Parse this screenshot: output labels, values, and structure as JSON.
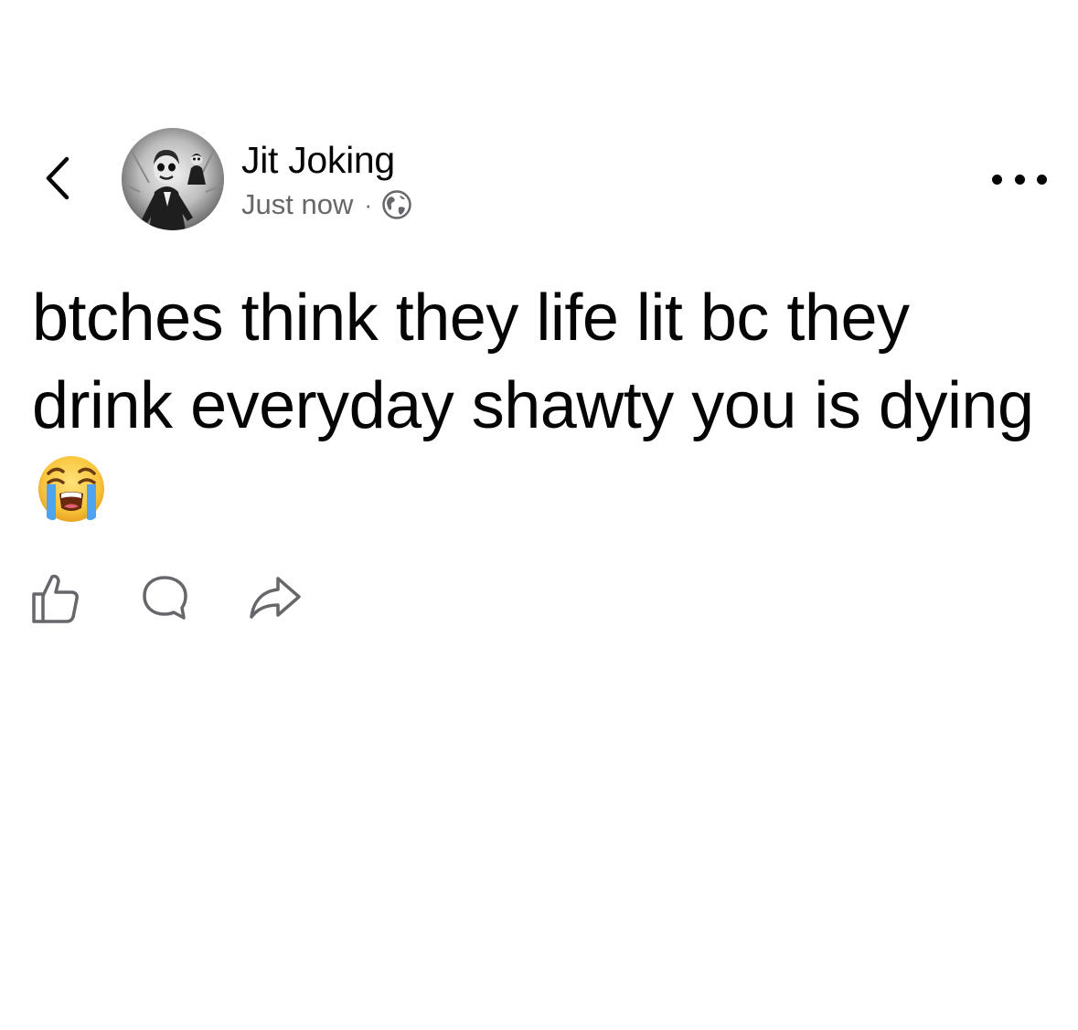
{
  "post": {
    "author": "Jit Joking",
    "timestamp": "Just now",
    "separator": "·",
    "audience_icon": "globe-icon",
    "text": "btches think they life lit bc they drink everyday shawty you is dying",
    "emoji": "loudly-crying-face-emoji"
  },
  "header": {
    "back_icon": "chevron-left-icon",
    "more_icon": "more-horizontal-icon"
  },
  "actions": [
    {
      "name": "like",
      "icon": "thumbs-up-icon"
    },
    {
      "name": "comment",
      "icon": "comment-bubble-icon"
    },
    {
      "name": "share",
      "icon": "share-arrow-icon"
    }
  ],
  "colors": {
    "text": "#050505",
    "secondary_text": "#65676b",
    "icon_gray": "#65676b",
    "background": "#ffffff"
  }
}
